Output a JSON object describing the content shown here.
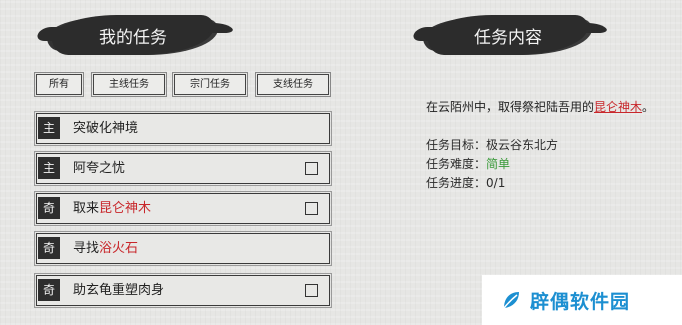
{
  "left_panel": {
    "title": "我的任务",
    "tabs": [
      "所有",
      "主线任务",
      "宗门任务",
      "支线任务"
    ]
  },
  "quests": [
    {
      "tag": "主",
      "title": "突破化神境",
      "highlight": "",
      "has_checkbox": false
    },
    {
      "tag": "主",
      "title": "阿夸之忧",
      "highlight": "",
      "has_checkbox": true
    },
    {
      "tag": "奇",
      "title": "取来",
      "highlight": "昆仑神木",
      "has_checkbox": true
    },
    {
      "tag": "奇",
      "title": "寻找",
      "highlight": "浴火石",
      "has_checkbox": false
    },
    {
      "tag": "奇",
      "title": "助玄龟重塑肉身",
      "highlight": "",
      "has_checkbox": true
    }
  ],
  "right_panel": {
    "title": "任务内容",
    "description": {
      "before": "在云陌州中，取得祭祀陆吾用的",
      "highlight": "昆仑神木",
      "after": "。"
    },
    "target": {
      "label": "任务目标：",
      "value": "极云谷东北方"
    },
    "difficulty": {
      "label": "任务难度：",
      "value": "简单"
    },
    "progress": {
      "label": "任务进度：",
      "value": "0/1"
    }
  },
  "watermark": {
    "text": "辟偶软件园",
    "icon": "leaf-logo-icon"
  },
  "colors": {
    "highlight_red": "#c8262a",
    "difficulty_green": "#3a9a3a",
    "ink": "#2c2c2c",
    "watermark_blue": "#1c8fd1"
  }
}
